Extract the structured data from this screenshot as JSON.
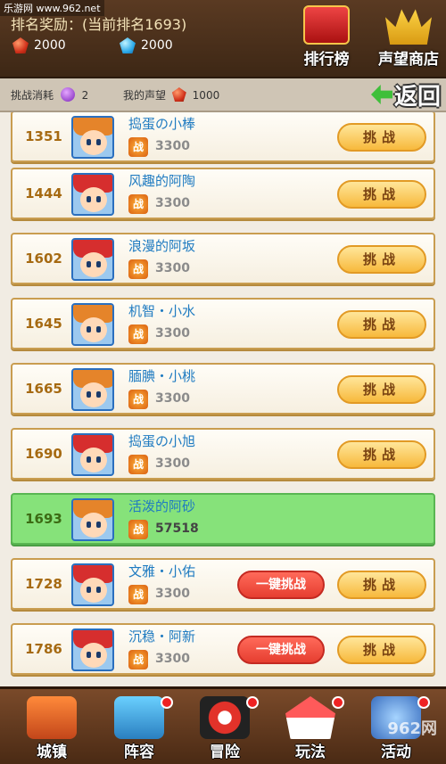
{
  "watermark": {
    "top": "乐游网 www.962.net",
    "bottom": "962网"
  },
  "header": {
    "rank_reward": "排名奖励：(当前排名1693)",
    "resources": [
      {
        "icon": "red-gem-icon",
        "value": "2000"
      },
      {
        "icon": "blue-diamond-icon",
        "value": "2000"
      }
    ],
    "buttons": [
      {
        "icon": "ranking-box-icon",
        "label": "排行榜"
      },
      {
        "icon": "crown-shop-icon",
        "label": "声望商店"
      }
    ]
  },
  "subbar": {
    "cost_label": "挑战消耗",
    "cost_icon": "essence-icon",
    "cost_icon_text": "精",
    "cost_value": "2",
    "prestige_label": "我的声望",
    "prestige_value": "1000",
    "back_label": "返回"
  },
  "list": {
    "challenge_label": "挑战",
    "quick_label": "一键挑战",
    "power_badge": "战",
    "rows": [
      {
        "rank": "1351",
        "name": "捣蛋の小棒",
        "power": "3300",
        "avatar": "orange"
      },
      {
        "rank": "1444",
        "name": "风趣的阿陶",
        "power": "3300",
        "avatar": "red"
      },
      {
        "rank": "1602",
        "name": "浪漫的阿坂",
        "power": "3300",
        "avatar": "red"
      },
      {
        "rank": "1645",
        "name": "机智・小水",
        "power": "3300",
        "avatar": "orange"
      },
      {
        "rank": "1665",
        "name": "腼腆・小桃",
        "power": "3300",
        "avatar": "orange"
      },
      {
        "rank": "1690",
        "name": "捣蛋の小旭",
        "power": "3300",
        "avatar": "red"
      },
      {
        "rank": "1693",
        "name": "活泼的阿砂",
        "power": "57518",
        "avatar": "orange",
        "me": true
      },
      {
        "rank": "1728",
        "name": "文雅・小佑",
        "power": "3300",
        "avatar": "red",
        "quick": true
      },
      {
        "rank": "1786",
        "name": "沉稳・阿新",
        "power": "3300",
        "avatar": "red",
        "quick": true
      }
    ]
  },
  "nav": [
    {
      "label": "城镇",
      "icon": "town-icon"
    },
    {
      "label": "阵容",
      "icon": "team-dragon-icon"
    },
    {
      "label": "冒险",
      "icon": "pokeball-adventure-icon"
    },
    {
      "label": "玩法",
      "icon": "carousel-play-icon"
    },
    {
      "label": "活动",
      "icon": "more-icon"
    }
  ]
}
